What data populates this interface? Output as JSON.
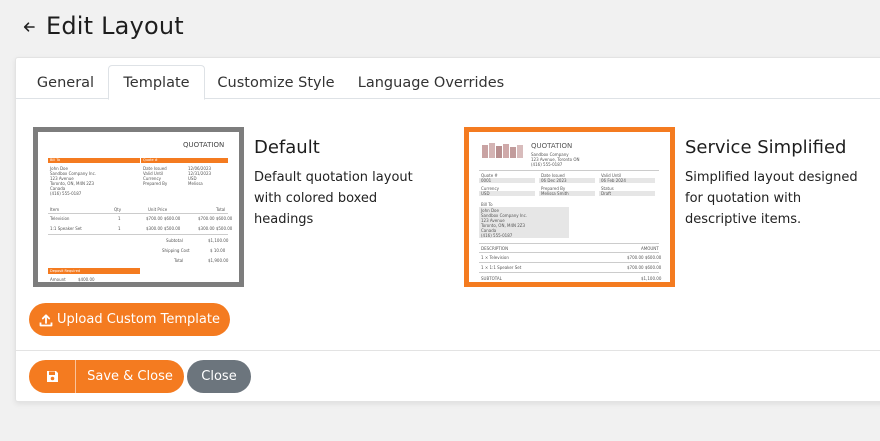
{
  "header": {
    "title": "Edit Layout",
    "back_icon": "arrow-left-icon"
  },
  "tabs": [
    {
      "label": "General",
      "active": false
    },
    {
      "label": "Template",
      "active": true
    },
    {
      "label": "Customize Style",
      "active": false
    },
    {
      "label": "Language Overrides",
      "active": false
    }
  ],
  "templates": [
    {
      "name": "Default",
      "description": "Default quotation layout with colored boxed headings",
      "selected": false,
      "preview": {
        "heading": "QUOTATION",
        "bill_to": "Bill To",
        "quote_no": "Quote #",
        "company_lines": [
          "John Doe",
          "Sandbox Company Inc.",
          "123 Avenue",
          "Toronto, ON, M4N 2Z3",
          "Canada",
          "(416) 555-0187"
        ],
        "meta_labels": [
          "Date Issued",
          "Valid Until",
          "Currency",
          "Prepared By"
        ],
        "meta_values": [
          "12/06/2023",
          "12/31/2023",
          "USD",
          "Melissa"
        ],
        "columns": [
          "Item",
          "Qty",
          "Unit Price",
          "Total"
        ],
        "rows": [
          [
            "Television",
            "1",
            "$700.00 $600.00",
            "$700.00 $600.00"
          ],
          [
            "1:1 Speaker Set",
            "1",
            "$300.00 $500.00",
            "$300.00 $500.00"
          ]
        ],
        "totals": [
          [
            "Subtotal",
            "$1,100.00"
          ],
          [
            "Shipping Cost",
            "$ 10.00"
          ],
          [
            "Total",
            "$1,900.00"
          ]
        ],
        "deposit": "Deposit Required",
        "deposit_label": "Amount",
        "deposit_value": "$400.00"
      }
    },
    {
      "name": "Service Simplified",
      "description": "Simplified layout designed for quotation with descriptive items.",
      "selected": true,
      "preview": {
        "heading": "QUOTATION",
        "sub_lines": [
          "Sandbox Company",
          "123 Avenue, Toronto ON",
          "(416) 555-0187"
        ],
        "field_labels": [
          "Quote #",
          "Date Issued",
          "Valid Until",
          "Currency",
          "Prepared By",
          "Status"
        ],
        "field_values": [
          "0001",
          "06 Dec 2023",
          "06 Feb 2024",
          "USD",
          "Melissa Smith",
          "Draft"
        ],
        "bill_to": "Bill To",
        "bill_lines": [
          "John Doe",
          "Sandbox Company Inc.",
          "123 Avenue",
          "Toronto, ON, M4N 2Z3",
          "Canada",
          "(416) 555-0187"
        ],
        "columns": [
          "DESCRIPTION",
          "AMOUNT"
        ],
        "rows": [
          [
            "1 × Television",
            "$700.00 $600.00"
          ],
          [
            "1 × 1:1 Speaker Set",
            "$700.00 $600.00"
          ]
        ],
        "subtotal_label": "SUBTOTAL",
        "subtotal_value": "$1,100.00"
      }
    }
  ],
  "buttons": {
    "upload": "Upload Custom Template",
    "save_close": "Save & Close",
    "close": "Close"
  },
  "colors": {
    "accent": "#f47b20",
    "secondary": "#6c757d",
    "unselected_border": "#7d7d7d"
  }
}
